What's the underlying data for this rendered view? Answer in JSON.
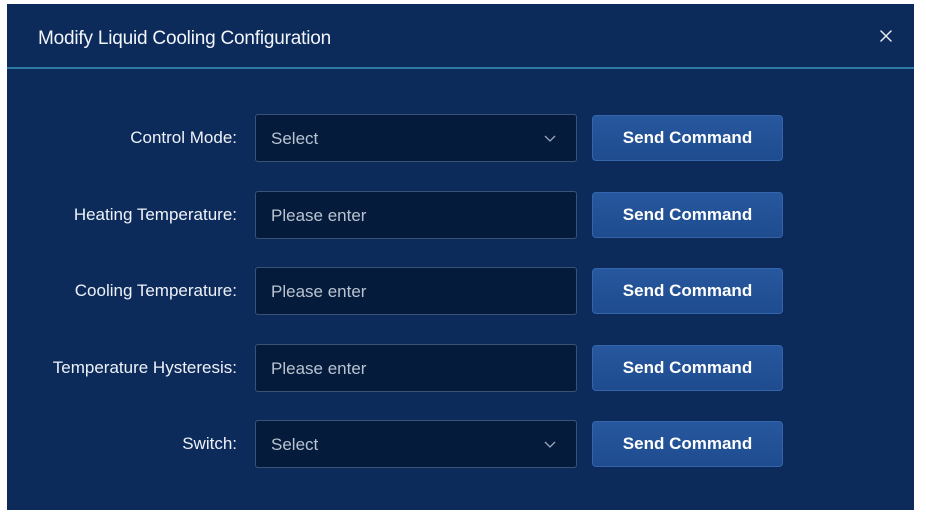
{
  "dialog": {
    "title": "Modify Liquid Cooling Configuration",
    "close_icon": "close-icon",
    "colors": {
      "background": "#0c2a5a",
      "header_divider": "#2e79a3",
      "field_background": "#051b3b",
      "button_background": "#27579e"
    }
  },
  "form": {
    "rows": [
      {
        "label": "Control Mode:",
        "type": "select",
        "value": "",
        "placeholder": "Select",
        "button": "Send Command"
      },
      {
        "label": "Heating Temperature:",
        "type": "input",
        "value": "",
        "placeholder": "Please enter",
        "button": "Send Command"
      },
      {
        "label": "Cooling Temperature:",
        "type": "input",
        "value": "",
        "placeholder": "Please enter",
        "button": "Send Command"
      },
      {
        "label": "Temperature Hysteresis:",
        "type": "input",
        "value": "",
        "placeholder": "Please enter",
        "button": "Send Command"
      },
      {
        "label": "Switch:",
        "type": "select",
        "value": "",
        "placeholder": "Select",
        "button": "Send Command"
      }
    ]
  }
}
